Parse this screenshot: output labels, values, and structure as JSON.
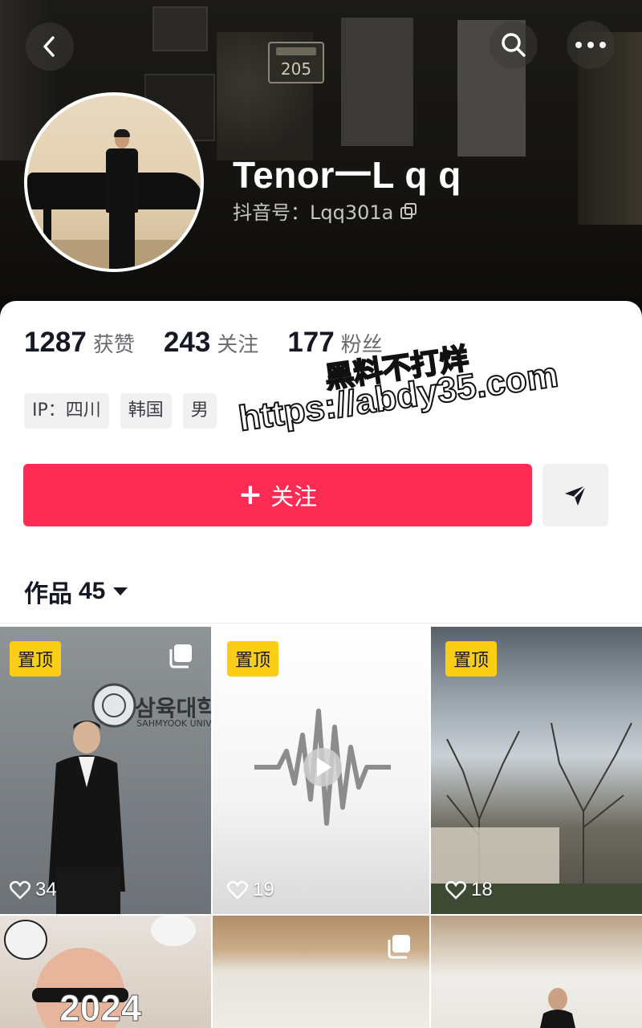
{
  "header": {
    "display_name": "Tenor一L q q",
    "account_id": "抖音号：Lqq301a",
    "door_number": "205"
  },
  "stats": [
    {
      "value": "1287",
      "label": "获赞"
    },
    {
      "value": "243",
      "label": "关注"
    },
    {
      "value": "177",
      "label": "粉丝"
    }
  ],
  "tags": [
    "IP：四川",
    "韩国",
    "男"
  ],
  "actions": {
    "follow_label": "关注"
  },
  "works_tab": {
    "label": "作品",
    "count": "45"
  },
  "videos": [
    {
      "pinned_label": "置顶",
      "likes": "34",
      "overlay_text": "삼육대학",
      "overlay_sub": "SAHMYOOK UNIV"
    },
    {
      "pinned_label": "置顶",
      "likes": "19"
    },
    {
      "pinned_label": "置顶",
      "likes": "18"
    },
    {
      "overlay_text": "2024"
    },
    {},
    {}
  ],
  "watermark": {
    "line1": "黑料不打烊",
    "line2": "https://abdy35.com"
  },
  "colors": {
    "follow_button": "#fe2c55",
    "pin_badge": "#face15",
    "text_primary": "#161823"
  }
}
